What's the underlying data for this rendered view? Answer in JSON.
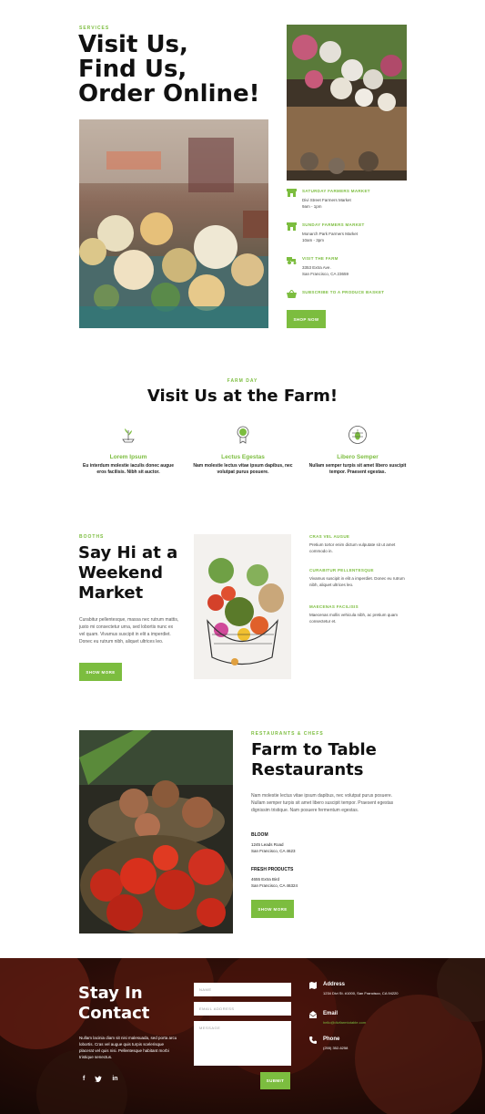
{
  "services": {
    "eyebrow": "SERVICES",
    "title_lines": [
      "Visit Us,",
      "Find Us,",
      "Order Online!"
    ],
    "locations": [
      {
        "title": "SATURDAY FARMERS MARKET",
        "line1": "Divi Street Farmers Market",
        "line2": "9am - 1pm",
        "icon": "store-icon"
      },
      {
        "title": "SUNDAY FARMERS MARKET",
        "line1": "Monarch Park Farmers Market",
        "line2": "10am - 3pm",
        "icon": "store-icon"
      },
      {
        "title": "VISIT THE FARM",
        "line1": "3353 Extra Ave.",
        "line2": "San Francisco, CA 23659",
        "icon": "tractor-icon"
      },
      {
        "title": "SUBSCRIBE TO A PRODUCE BASKET",
        "line1": "",
        "line2": "",
        "icon": "basket-icon"
      }
    ],
    "shop_button": "SHOP NOW"
  },
  "farm_day": {
    "eyebrow": "FARM DAY",
    "title": "Visit Us at the Farm!",
    "features": [
      {
        "title": "Lorem Ipsum",
        "text": "Eu interdum molestie iaculis donec augue eros facilisis. Nibh sit auctor.",
        "icon": "sprout-icon"
      },
      {
        "title": "Lectus Egestas",
        "text": "Nam molestie lectus vitae ipsum dapibus, nec volutpat purus posuere.",
        "icon": "award-icon"
      },
      {
        "title": "Libero Semper",
        "text": "Nullam semper turpis sit amet libero suscipit tempor. Praesent egestas.",
        "icon": "bug-icon"
      }
    ]
  },
  "booths": {
    "eyebrow": "BOOTHS",
    "title_lines": [
      "Say Hi at a",
      "Weekend",
      "Market"
    ],
    "body": "Curabitur pellentesque, massa nec rutrum mattis, justo mi consectetur urna, sed lobortis nunc ex vel quam. Vivamus suscipit in elit a imperdiet. Donec eu rutrum nibh, aliquet ultrices leo.",
    "button": "SHOW MORE",
    "items": [
      {
        "title": "CRAS VEL AUGUE",
        "text": "Pretium tortor enim dictum vulputate sit ut amet commodo in."
      },
      {
        "title": "CURABITUR PELLENTESQUE",
        "text": "Vivamus suscipit in elit a imperdiet. Donec eu rutrum nibh, aliquet ultrices leo."
      },
      {
        "title": "MAECENAS FACILISIS",
        "text": "Maecenas mollis vehicula nibh, ac pretium quam consectetur et."
      }
    ]
  },
  "restaurants": {
    "eyebrow": "RESTAURANTS & CHEFS",
    "title_lines": [
      "Farm to Table",
      "Restaurants"
    ],
    "body": "Nam molestie lectus vitae ipsum dapibus, nec volutpat purus posuere. Nullam semper turpis sit amet libero suscipit tempor. Praesent egestas dignissim tristique. Nam posuere fermentum egestas.",
    "places": [
      {
        "name": "BLOOM",
        "line1": "1245 Leads Road",
        "line2": "San Francisco, CA 4623"
      },
      {
        "name": "FRESH PRODUCTS",
        "line1": "4655 Extra Bird",
        "line2": "San Francisco, CA 46324"
      }
    ],
    "button": "SHOW MORE"
  },
  "contact": {
    "title_lines": [
      "Stay In",
      "Contact"
    ],
    "body": "Nullam lacinia diam sit nisi malesuada, sed porta arcu lobortis. Cras vel augue quis turpis scelerisque placerat vel quis nisi. Pellentesque habitant morbi tristique senectus.",
    "social": [
      "facebook-icon",
      "twitter-icon",
      "linkedin-icon"
    ],
    "form": {
      "name_placeholder": "NAME",
      "email_placeholder": "EMAIL ADDRESS",
      "message_placeholder": "MESSAGE",
      "submit": "SUBMIT"
    },
    "info": [
      {
        "label": "Address",
        "value": "1234 Divi St. #1000, San Francisco, CA 94220",
        "icon": "map-icon"
      },
      {
        "label": "Email",
        "value": "hello@divifarmtotable.com",
        "icon": "envelope-icon"
      },
      {
        "label": "Phone",
        "value": "(255) 352-6258",
        "icon": "phone-icon"
      }
    ]
  },
  "colors": {
    "accent": "#7cbd3f",
    "text": "#111111",
    "footer_bg": "#3a1a12"
  }
}
